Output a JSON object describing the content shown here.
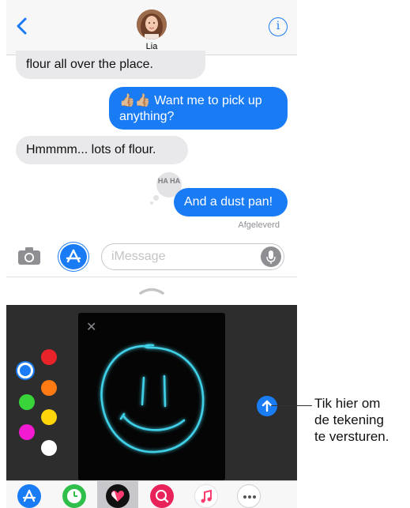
{
  "header": {
    "contact_name": "Lia",
    "info_label": "i"
  },
  "messages": [
    {
      "direction": "received",
      "text": "flour all over the place."
    },
    {
      "direction": "sent",
      "text": "👍🏼👍🏼 Want me to pick up anything?"
    },
    {
      "direction": "received",
      "text": "Hmmmm... lots of flour."
    },
    {
      "direction": "sent",
      "text": "And a dust pan!",
      "tapback": "HA HA"
    }
  ],
  "status": {
    "delivered": "Afgeleverd"
  },
  "composer": {
    "placeholder": "iMessage"
  },
  "drawing": {
    "close_label": "✕",
    "colors": [
      "#1a7cf5",
      "#e8232a",
      "#ff7a12",
      "#39d43a",
      "#ffd60a",
      "#f21bd2",
      "#ffffff"
    ],
    "selected_color": "#1a7cf5",
    "sketch_color": "#3fd0e8"
  },
  "app_drawer": {
    "apps": [
      "app-store-icon",
      "clock-icon",
      "digital-touch-icon",
      "image-search-icon",
      "music-icon",
      "more-icon"
    ],
    "selected": "digital-touch-icon"
  },
  "callout": {
    "line1": "Tik hier om",
    "line2": "de tekening",
    "line3": "te versturen."
  },
  "colors": {
    "accent": "#1a7cf5",
    "received_bubble": "#e9e9eb",
    "panel_bg": "#2d2d2d"
  }
}
